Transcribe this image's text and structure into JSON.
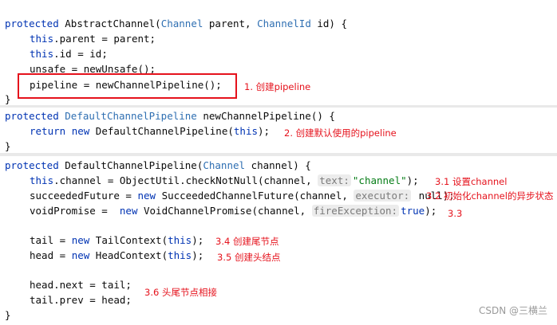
{
  "panel1": {
    "l1": {
      "kw": "protected",
      "type": "AbstractChannel",
      "open": "(",
      "ptype1": "Channel",
      "p1": " parent, ",
      "ptype2": "ChannelId",
      "p2": " id) {"
    },
    "l2": {
      "kw": "this",
      "rest": ".parent = parent;"
    },
    "l3": {
      "kw": "this",
      "rest": ".id = id;"
    },
    "l4": "unsafe = newUnsafe();",
    "l5": "pipeline = newChannelPipeline();",
    "l6": "}",
    "annotation": "1. 创建pipeline"
  },
  "panel2": {
    "l1": {
      "kw": "protected",
      "type": "DefaultChannelPipeline",
      "rest": " newChannelPipeline() {"
    },
    "l2": {
      "kw": "return",
      "kw2": "new",
      "rest1": " DefaultChannelPipeline(",
      "kw3": "this",
      "rest2": ");"
    },
    "l3": "}",
    "annotation": "2. 创建默认使用的pipeline"
  },
  "panel3": {
    "l1": {
      "kw": "protected",
      "rest1": " DefaultChannelPipeline(",
      "ptype": "Channel",
      "rest2": " channel) {"
    },
    "l2": {
      "kw": "this",
      "rest1": ".channel = ObjectUtil.checkNotNull(channel, ",
      "hint": "text:",
      "str": "\"channel\"",
      "rest2": ");"
    },
    "l3": {
      "pre": "succeededFuture = ",
      "kw": "new",
      "rest1": " SucceededChannelFuture(channel, ",
      "hint": "executor:",
      "rest2": " null);"
    },
    "l4": {
      "pre": "voidPromise =  ",
      "kw": "new",
      "rest1": " VoidChannelPromise(channel, ",
      "hint": "fireException:",
      "kw2": "true",
      "rest2": ");"
    },
    "l5": {
      "pre": "tail = ",
      "kw": "new",
      "rest1": " TailContext(",
      "kw2": "this",
      "rest2": ");"
    },
    "l6": {
      "pre": "head = ",
      "kw": "new",
      "rest1": " HeadContext(",
      "kw2": "this",
      "rest2": ");"
    },
    "l7": "head.next = tail;",
    "l8": "tail.prev = head;",
    "l9": "}",
    "annotations": {
      "a31": "3.1 设置channel",
      "a32": "3.2 初始化channel的异步状态",
      "a33": "3.3",
      "a34": "3.4 创建尾节点",
      "a35": "3.5 创建头结点",
      "a36": "3.6 头尾节点相接"
    }
  },
  "watermark": "CSDN @三横兰",
  "colors": {
    "keyword": "#0033b3",
    "type": "#2f6fb2",
    "string": "#067d17",
    "annotation": "#e5121c"
  }
}
